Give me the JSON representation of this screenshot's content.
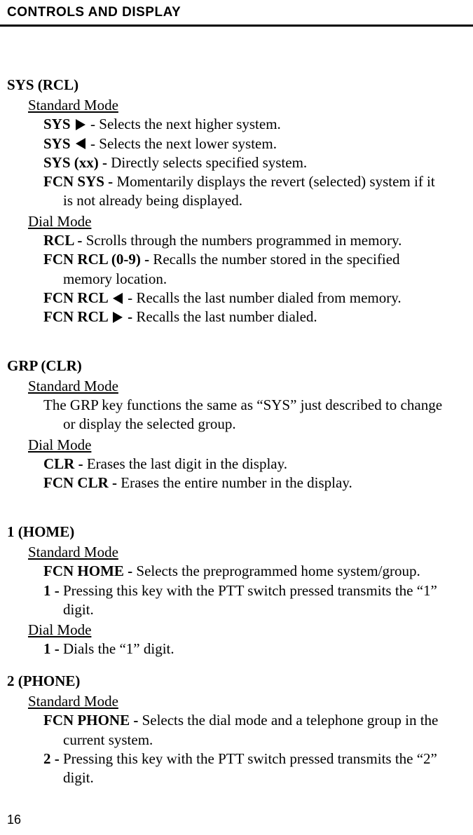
{
  "header": "CONTROLS AND DISPLAY",
  "sys_rcl": {
    "title": "SYS (RCL)",
    "standard_label": "Standard Mode",
    "sys_right_prefix": "SYS  ",
    "sys_right_desc": " - Selects the next higher system.",
    "sys_left_prefix": "SYS  ",
    "sys_left_desc": " - Selects the next lower system.",
    "sys_xx_prefix": "SYS (xx) - ",
    "sys_xx_desc": "Directly selects specified system.",
    "fcn_sys_prefix": "FCN SYS - ",
    "fcn_sys_desc1": "Momentarily displays the revert (selected) system if it",
    "fcn_sys_desc2": "is not already being displayed.",
    "dial_label": "Dial Mode",
    "rcl_prefix": "RCL - ",
    "rcl_desc": "Scrolls through the numbers programmed in memory.",
    "fcn_rcl09_prefix": "FCN RCL (0-9) - ",
    "fcn_rcl09_desc1": "Recalls the number stored in the specified",
    "fcn_rcl09_desc2": "memory location.",
    "fcn_rcl_left_prefix": "FCN RCL  ",
    "fcn_rcl_left_desc": " - Recalls the last number dialed from memory.",
    "fcn_rcl_right_prefix": "FCN RCL  ",
    "fcn_rcl_right_dash": " - ",
    "fcn_rcl_right_desc": "Recalls the last number dialed."
  },
  "grp_clr": {
    "title": "GRP (CLR)",
    "standard_label": "Standard Mode",
    "grp_desc1": "The GRP key functions the same as “SYS” just described to change",
    "grp_desc2": "or display the selected group.",
    "dial_label": "Dial Mode",
    "clr_prefix": "CLR - ",
    "clr_desc": "Erases the last digit in the display.",
    "fcn_clr_prefix": "FCN CLR - ",
    "fcn_clr_desc": "Erases the entire number in the display."
  },
  "home": {
    "title": "1 (HOME)",
    "standard_label": "Standard Mode",
    "fcn_home_prefix": "FCN HOME - ",
    "fcn_home_desc": "Selects the preprogrammed home system/group.",
    "one_prefix": "1 - ",
    "one_desc1": "Pressing this key with the PTT switch pressed transmits the “1”",
    "one_desc2": "digit.",
    "dial_label": "Dial Mode",
    "one_dial_prefix": "1 - ",
    "one_dial_desc": "Dials the “1” digit."
  },
  "phone": {
    "title": "2 (PHONE)",
    "standard_label": "Standard Mode",
    "fcn_phone_prefix": "FCN PHONE - ",
    "fcn_phone_desc1": "Selects the dial mode and a telephone group in the",
    "fcn_phone_desc2": "current system.",
    "two_prefix": "2 - ",
    "two_desc1": "Pressing this key with the PTT switch pressed transmits the “2”",
    "two_desc2": "digit."
  },
  "page_number": "16"
}
